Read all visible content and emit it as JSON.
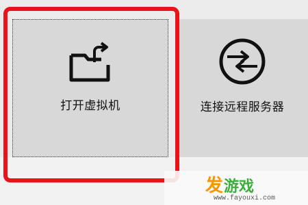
{
  "tiles": [
    {
      "id": "open",
      "label": "打开虚拟机",
      "icon": "folder-open-icon"
    },
    {
      "id": "connect",
      "label": "连接远程服务器",
      "icon": "remote-connect-icon"
    }
  ],
  "highlight_color": "#e8141b",
  "watermark": {
    "text": "发游戏",
    "url": "www.fayouxi.com",
    "colors": {
      "orange": "#f39800",
      "green": "#3aae3a"
    }
  }
}
